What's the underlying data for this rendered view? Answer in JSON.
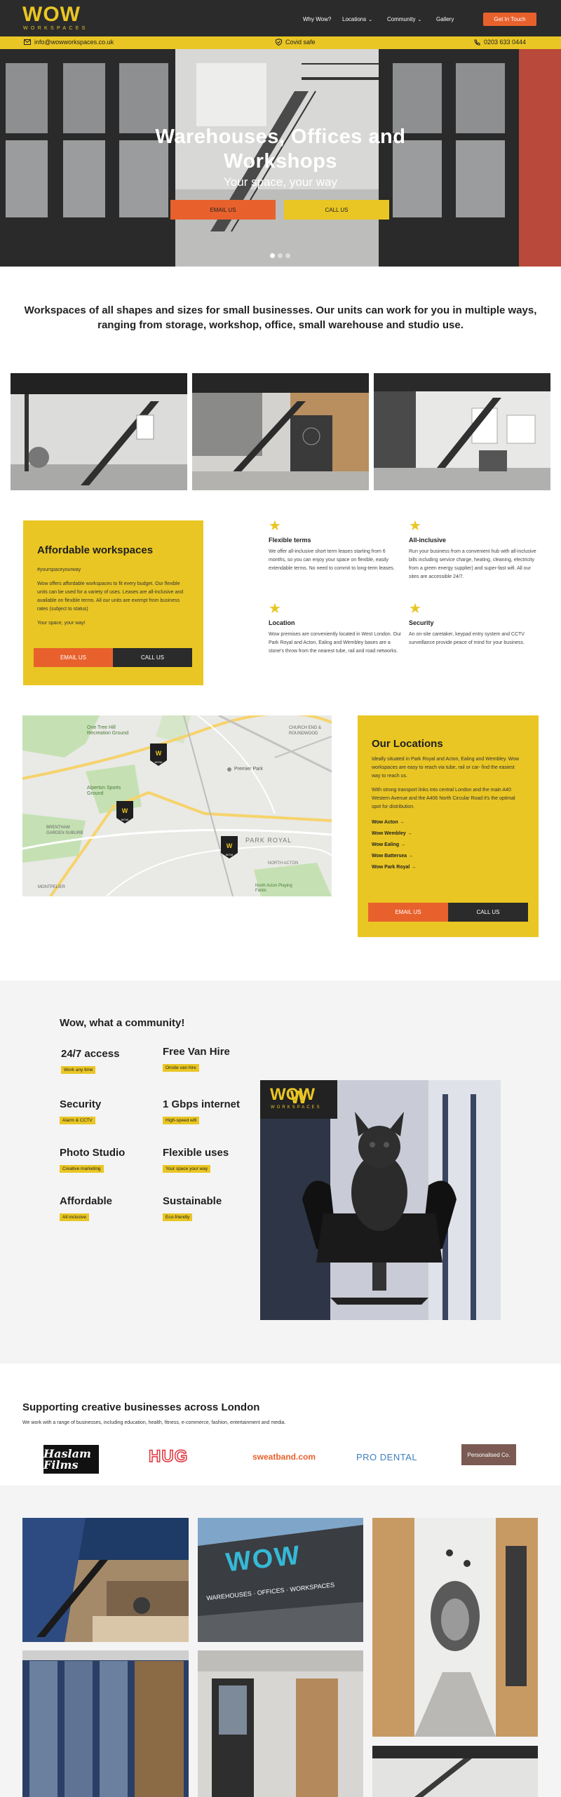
{
  "header": {
    "logo_word": "WOW",
    "logo_sub": "WORKSPACES",
    "nav": [
      "Why Wow?",
      "Locations",
      "Community",
      "Gallery"
    ],
    "cta": "Get In Touch"
  },
  "strip": {
    "email": "info@wowworkspaces.co.uk",
    "covid": "Covid safe",
    "phone": "0203 633 0444"
  },
  "hero": {
    "title_line1": "Warehouses, Offices and",
    "title_line2": "Workshops",
    "subtitle": "Your space, your way",
    "btn_email": "EMAIL US",
    "btn_call": "CALL US"
  },
  "intro": "Workspaces of all shapes and sizes for small businesses. Our units can work for you in multiple ways, ranging from storage, workshop, office, small warehouse and studio use.",
  "affordable": {
    "title": "Affordable workspaces",
    "hashtag": "#yourspaceyourway",
    "body": "Wow offers affordable workspaces to fit every budget. Our flexible units can be used for a variety of uses. Leases are all-inclusive and available on flexible terms. All our units are exempt from business rates (subject to status)",
    "tagline": "Your space, your way!",
    "btn_email": "EMAIL US",
    "btn_call": "CALL US"
  },
  "features": [
    {
      "title": "Flexible terms",
      "body": "We offer all-inclusive short term leases starting from 6 months, so you can enjoy your space on flexible, easily extendable terms. No need to commit to long-term leases."
    },
    {
      "title": "All-inclusive",
      "body": "Run your business from a convenient hub with all-inclusive bills including service charge, heating, cleaning, electricity from a green energy supplier) and super-fast wifi. All our sites are accessible 24/7."
    },
    {
      "title": "Location",
      "body": "Wow premises are conveniently located in West London. Our Park Royal and Acton, Ealing and Wembley bases are a stone's throw from the nearest tube, rail and road networks."
    },
    {
      "title": "Security",
      "body": "An on-site caretaker, keypad entry system and CCTV surveillance provide peace of mind for your business."
    }
  ],
  "map": {
    "labels": [
      "One Tree Hill Recreation Ground",
      "CHURCH END & ROUNDWOOD",
      "Premier Park",
      "Alperton Sports Ground",
      "BRENTHAM GARDEN SUBURB",
      "PARK ROYAL",
      "MONTPELIER",
      "NORTH ACTON",
      "North Acton Playing Fields"
    ],
    "pins": [
      "WOW",
      "WOW",
      "WOW"
    ]
  },
  "locations": {
    "title": "Our Locations",
    "p1": "Ideally situated in Park Royal and Acton, Ealing and Wembley. Wow workspaces are easy to reach via tube, rail or car- find the easiest way to reach us.",
    "p2": "With strong transport links into central London and the main A40 Western Avenue and the A406 North Circular Road it's the optimal spot for distribution.",
    "links": [
      "Wow Acton →",
      "Wow Wembley →",
      "Wow Ealing →",
      "Wow Battersea →",
      "Wow Park Royal →"
    ],
    "btn_email": "EMAIL US",
    "btn_call": "CALL US"
  },
  "community": {
    "title": "Wow, what a community!",
    "items": [
      {
        "title": "24/7 access",
        "badge": "Work any time"
      },
      {
        "title": "Free Van Hire",
        "badge": "Onsite van hire"
      },
      {
        "title": "Security",
        "badge": "Alarm & CCTV"
      },
      {
        "title": "1 Gbps internet",
        "badge": "High-speed wifi"
      },
      {
        "title": "Photo Studio",
        "badge": "Creative marketing"
      },
      {
        "title": "Flexible uses",
        "badge": "Your space your way"
      },
      {
        "title": "Affordable",
        "badge": "All inclusive"
      },
      {
        "title": "Sustainable",
        "badge": "Eco-friendly"
      }
    ]
  },
  "supporting": {
    "title": "Supporting creative businesses across London",
    "subtitle": "We work with a range of businesses, including education, health, fitness, e-commerce, fashion, entertainment and media.",
    "logos": [
      "Haslam Films",
      "HUG",
      "sweatband.com",
      "PRO DENTAL",
      "Personalised Co."
    ]
  },
  "building_sign": {
    "line1": "WOW",
    "line2": "WAREHOUSES · OFFICES · WORKSPACES"
  },
  "colors": {
    "yellow": "#e9c623",
    "orange": "#e8612c",
    "dark": "#2b2b2b"
  }
}
